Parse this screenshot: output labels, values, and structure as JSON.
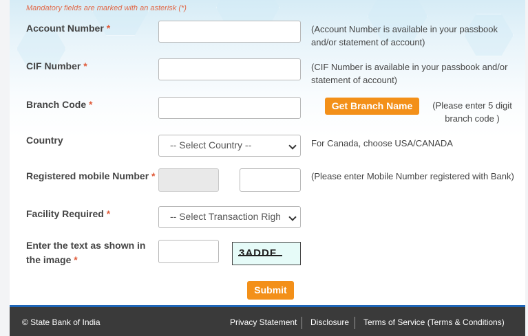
{
  "form": {
    "mandatory_note": "Mandatory fields are marked with an asterisk (*)",
    "account_number": {
      "label": "Account Number",
      "help": "(Account Number is available in your passbook and/or statement of account)"
    },
    "cif_number": {
      "label": "CIF Number",
      "help": "(CIF Number is available in your passbook and/or statement of account)"
    },
    "branch_code": {
      "label": "Branch Code",
      "button": "Get Branch Name",
      "help": "(Please enter 5 digit branch code )"
    },
    "country": {
      "label": "Country",
      "selected": "-- Select Country --",
      "help": "For Canada, choose USA/CANADA"
    },
    "mobile": {
      "label": "Registered mobile Number",
      "help": "(Please enter Mobile Number registered with Bank)"
    },
    "facility": {
      "label": "Facility Required",
      "selected": "-- Select Transaction Rights --"
    },
    "captcha": {
      "label_line1": "Enter the text as shown in",
      "label_line2": "the image",
      "image_text": "3ADDF"
    },
    "submit": "Submit",
    "asterisk": "*"
  },
  "footer": {
    "copyright": "© State Bank of India",
    "links": [
      "Privacy Statement",
      "Disclosure",
      "Terms of Service (Terms & Conditions)"
    ]
  },
  "colors": {
    "accent": "#f39019",
    "required": "#e05b3a",
    "footer_bg": "#3a3a3a",
    "footer_border": "#1e66b8"
  }
}
